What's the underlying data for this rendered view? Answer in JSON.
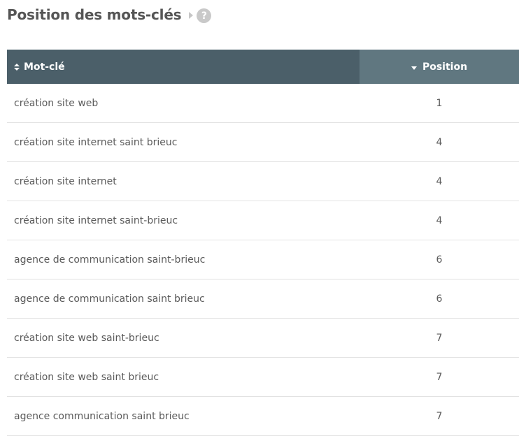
{
  "header": {
    "title": "Position des mots-clés",
    "help_glyph": "?"
  },
  "table": {
    "columns": {
      "keyword": "Mot-clé",
      "position": "Position"
    },
    "rows": [
      {
        "keyword": "création site web",
        "position": "1"
      },
      {
        "keyword": "création site internet saint brieuc",
        "position": "4"
      },
      {
        "keyword": "création site internet",
        "position": "4"
      },
      {
        "keyword": "création site internet saint-brieuc",
        "position": "4"
      },
      {
        "keyword": "agence de communication saint-brieuc",
        "position": "6"
      },
      {
        "keyword": "agence de communication saint brieuc",
        "position": "6"
      },
      {
        "keyword": "création site web saint-brieuc",
        "position": "7"
      },
      {
        "keyword": "création site web saint brieuc",
        "position": "7"
      },
      {
        "keyword": "agence communication saint brieuc",
        "position": "7"
      }
    ]
  },
  "colors": {
    "header_keyword_bg": "#4b5f69",
    "header_position_bg": "#607780",
    "help_icon_bg": "#c9c9c9"
  },
  "icons": {
    "sort_keyword": "sort-both-icon",
    "sort_position": "sort-desc-icon",
    "expand": "caret-right-icon",
    "help": "help-icon"
  }
}
